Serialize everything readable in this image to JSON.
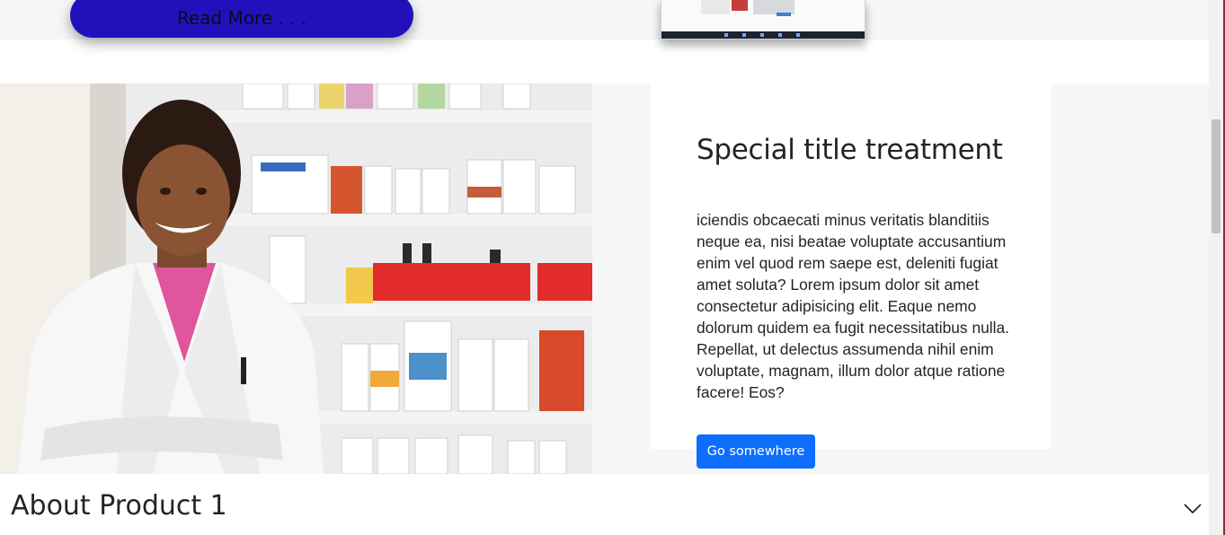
{
  "top": {
    "read_more_label": "Read More . . ."
  },
  "feature": {
    "image_alt": "Smiling pharmacist in a white coat standing in front of pharmacy shelves",
    "card": {
      "title": "Special title treatment",
      "text": "iciendis obcaecati minus veritatis blanditiis neque ea, nisi beatae voluptate accusantium enim vel quod rem saepe est, deleniti fugiat amet soluta? Lorem ipsum dolor sit amet consectetur adipisicing elit. Eaque nemo dolorum quidem ea fugit necessitatibus nulla. Repellat, ut delectus assumenda nihil enim voluptate, magnam, illum dolor atque ratione facere! Eos?",
      "button_label": "Go somewhere"
    }
  },
  "about": {
    "title": "About Product 1",
    "toggle_icon": "chevron-down-icon"
  },
  "colors": {
    "read_more_bg": "#2211bb",
    "primary_button": "#0d6efd",
    "section_bg": "#f5f6f8"
  }
}
